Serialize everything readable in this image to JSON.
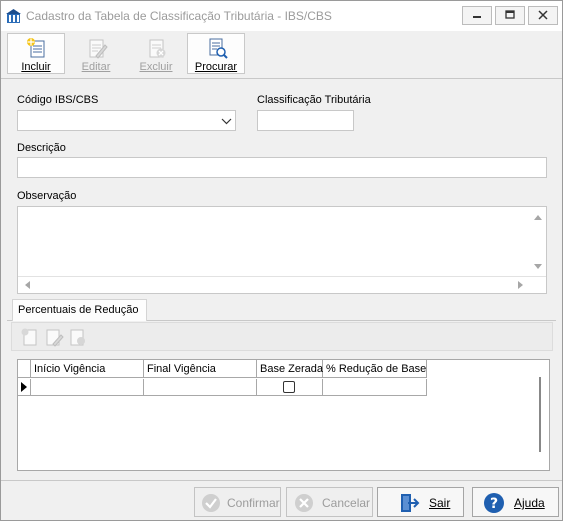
{
  "window": {
    "title": "Cadastro da Tabela de Classificação Tributária - IBS/CBS"
  },
  "toolbar": {
    "buttons": [
      {
        "label": "Incluir",
        "icon": "add-document-icon",
        "enabled": true
      },
      {
        "label": "Editar",
        "icon": "edit-document-icon",
        "enabled": false
      },
      {
        "label": "Excluir",
        "icon": "delete-document-icon",
        "enabled": false
      },
      {
        "label": "Procurar",
        "icon": "search-document-icon",
        "enabled": true
      }
    ]
  },
  "form": {
    "codigo_label": "Código IBS/CBS",
    "codigo_value": "",
    "classificacao_label": "Classificação Tributária",
    "classificacao_value": "",
    "descricao_label": "Descrição",
    "descricao_value": "",
    "observacao_label": "Observação",
    "observacao_value": ""
  },
  "tabs": [
    {
      "label": "Percentuais de Redução",
      "active": true
    }
  ],
  "grid": {
    "columns": [
      "Início Vigência",
      "Final Vigência",
      "Base Zerada",
      "% Redução de Base"
    ],
    "rows": [
      {
        "inicio": "",
        "final": "",
        "base_zerada": false,
        "reducao": ""
      }
    ]
  },
  "footer": {
    "confirmar": "Confirmar",
    "cancelar": "Cancelar",
    "sair": "Sair",
    "ajuda": "Ajuda"
  },
  "colors": {
    "accent": "#1f5fb0",
    "disabled_text": "#a0a0a0"
  }
}
